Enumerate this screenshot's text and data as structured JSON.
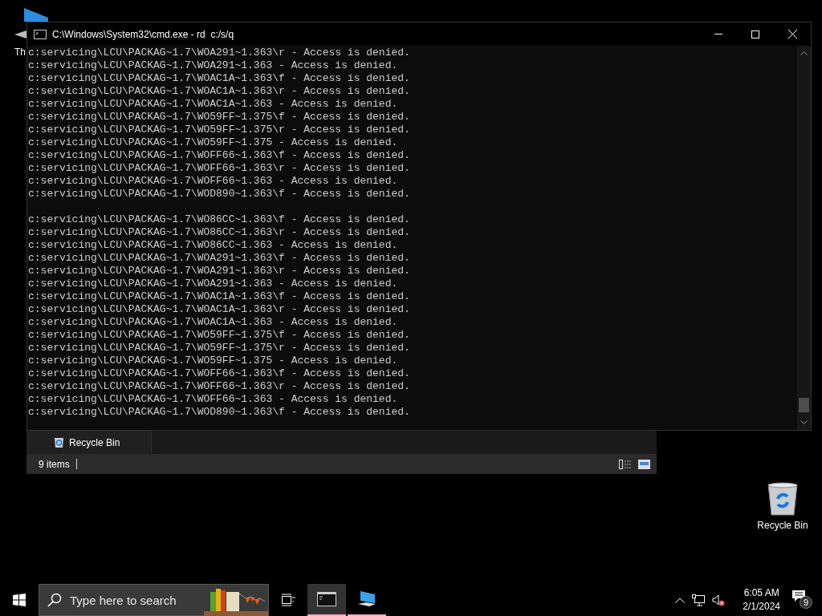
{
  "desktop_icons": [
    {
      "label": "Th"
    },
    {
      "label": "Recycle Bin"
    }
  ],
  "explorer_window": {
    "tab": "Recycle Bin",
    "status": "9 items"
  },
  "console_window": {
    "title": "C:\\Windows\\System32\\cmd.exe - rd  c:/s/q",
    "blocks": [
      [
        "c:servicing\\LCU\\PACKAG~1.7\\WOA291~1.363\\r - Access is denied.",
        "c:servicing\\LCU\\PACKAG~1.7\\WOA291~1.363 - Access is denied.",
        "c:servicing\\LCU\\PACKAG~1.7\\WOAC1A~1.363\\f - Access is denied.",
        "c:servicing\\LCU\\PACKAG~1.7\\WOAC1A~1.363\\r - Access is denied.",
        "c:servicing\\LCU\\PACKAG~1.7\\WOAC1A~1.363 - Access is denied.",
        "c:servicing\\LCU\\PACKAG~1.7\\WO59FF~1.375\\f - Access is denied.",
        "c:servicing\\LCU\\PACKAG~1.7\\WO59FF~1.375\\r - Access is denied.",
        "c:servicing\\LCU\\PACKAG~1.7\\WO59FF~1.375 - Access is denied.",
        "c:servicing\\LCU\\PACKAG~1.7\\WOFF66~1.363\\f - Access is denied.",
        "c:servicing\\LCU\\PACKAG~1.7\\WOFF66~1.363\\r - Access is denied.",
        "c:servicing\\LCU\\PACKAG~1.7\\WOFF66~1.363 - Access is denied.",
        "c:servicing\\LCU\\PACKAG~1.7\\WOD890~1.363\\f - Access is denied."
      ],
      [
        "c:servicing\\LCU\\PACKAG~1.7\\WO86CC~1.363\\f - Access is denied.",
        "c:servicing\\LCU\\PACKAG~1.7\\WO86CC~1.363\\r - Access is denied.",
        "c:servicing\\LCU\\PACKAG~1.7\\WO86CC~1.363 - Access is denied.",
        "c:servicing\\LCU\\PACKAG~1.7\\WOA291~1.363\\f - Access is denied.",
        "c:servicing\\LCU\\PACKAG~1.7\\WOA291~1.363\\r - Access is denied.",
        "c:servicing\\LCU\\PACKAG~1.7\\WOA291~1.363 - Access is denied.",
        "c:servicing\\LCU\\PACKAG~1.7\\WOAC1A~1.363\\f - Access is denied.",
        "c:servicing\\LCU\\PACKAG~1.7\\WOAC1A~1.363\\r - Access is denied.",
        "c:servicing\\LCU\\PACKAG~1.7\\WOAC1A~1.363 - Access is denied.",
        "c:servicing\\LCU\\PACKAG~1.7\\WO59FF~1.375\\f - Access is denied.",
        "c:servicing\\LCU\\PACKAG~1.7\\WO59FF~1.375\\r - Access is denied.",
        "c:servicing\\LCU\\PACKAG~1.7\\WO59FF~1.375 - Access is denied.",
        "c:servicing\\LCU\\PACKAG~1.7\\WOFF66~1.363\\f - Access is denied.",
        "c:servicing\\LCU\\PACKAG~1.7\\WOFF66~1.363\\r - Access is denied.",
        "c:servicing\\LCU\\PACKAG~1.7\\WOFF66~1.363 - Access is denied.",
        "c:servicing\\LCU\\PACKAG~1.7\\WOD890~1.363\\f - Access is denied."
      ]
    ]
  },
  "taskbar": {
    "search": {
      "placeholder": "Type here to search"
    },
    "apps": [
      {
        "kind": "console",
        "selected": true
      },
      {
        "kind": "computer",
        "selected": false
      }
    ],
    "time": "6:05 AM",
    "date": "2/1/2024",
    "notifications": "9"
  }
}
